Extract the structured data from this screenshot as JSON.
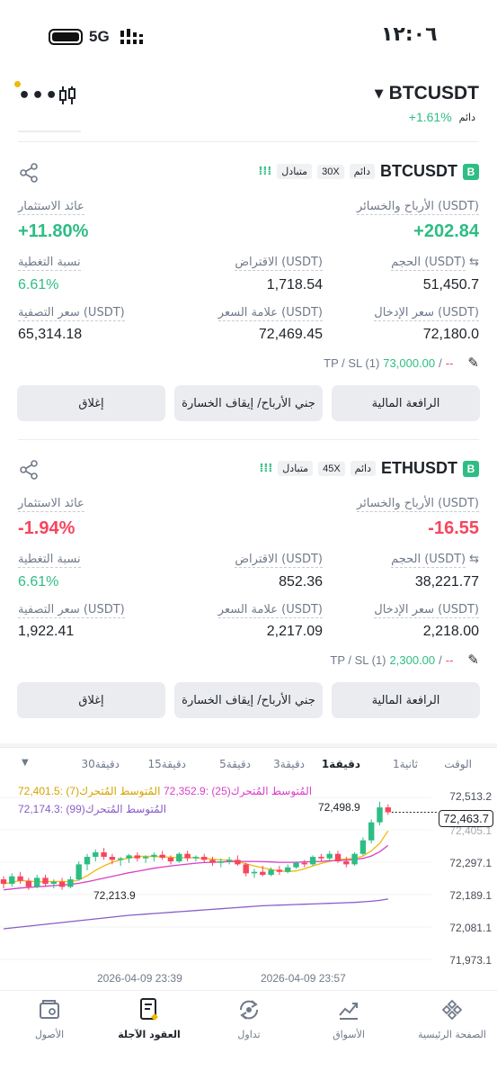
{
  "status_bar": {
    "time": "١٢:٠٦",
    "network": "5G"
  },
  "header": {
    "symbol": "BTCUSDT",
    "type": "دائم",
    "change": "+1.61%"
  },
  "labels": {
    "exchange": "متبادل",
    "perpetual": "دائم",
    "roi": "عائد الاستثمار",
    "pnl": "الأرباح والخسائر (USDT)",
    "margin_ratio": "نسبة التغطية",
    "margin": "الاقتراض (USDT)",
    "size": "الحجم (USDT)",
    "liq_price": "سعر التصفية (USDT)",
    "mark_price": "علامة السعر (USDT)",
    "entry_price": "سعر الإدخال (USDT)",
    "tpsl_prefix": "TP / SL (1)",
    "leverage_btn": "الرافعة المالية",
    "tpsl_btn": "جني الأرباح/ إيقاف الخسارة",
    "close_btn": "إغلاق"
  },
  "positions": [
    {
      "badge": "B",
      "symbol": "BTCUSDT",
      "leverage": "30X",
      "roi": "+11.80%",
      "pnl": "+202.84",
      "margin_ratio": "6.61%",
      "margin": "1,718.54",
      "size": "51,450.7",
      "liq_price": "65,314.18",
      "mark_price": "72,469.45",
      "entry_price": "72,180.0",
      "tp": "73,000.00",
      "sl": "--"
    },
    {
      "badge": "B",
      "symbol": "ETHUSDT",
      "leverage": "45X",
      "roi": "-1.94%",
      "pnl": "-16.55",
      "margin_ratio": "6.61%",
      "margin": "852.36",
      "size": "38,221.77",
      "liq_price": "1,922.41",
      "mark_price": "2,217.09",
      "entry_price": "2,218.00",
      "tp": "2,300.00",
      "sl": "--"
    }
  ],
  "timeframes": [
    "الوقت",
    "1ثانية",
    "1دقيقة",
    "3دقيقة",
    "5دقيقة",
    "15دقيقة",
    "30دقيقة"
  ],
  "chart": {
    "ma7": "المُتوسط المُتحرك(7) :72,401.5",
    "ma25": "المُتوسط المُتحرك(25) :72,352.9",
    "ma99": "المُتوسط المُتحرك(99) :72,174.3",
    "high_label": "72,498.9",
    "low_label": "72,213.9",
    "current_price": "72,463.7",
    "y_labels": [
      "72,513.2",
      "72,405.1",
      "72,297.1",
      "72,189.1",
      "72,081.1",
      "71,973.1"
    ],
    "x_labels": [
      "2026-04-09 23:39",
      "2026-04-09 23:57"
    ],
    "colors": {
      "ma7": "#f0b90b",
      "ma25": "#d93ec8",
      "ma99": "#8a5cc9",
      "up": "#2ebd85",
      "down": "#f6465d"
    }
  },
  "chart_data": {
    "type": "candlestick",
    "ylim": [
      71973.1,
      72513.2
    ],
    "y_ticks": [
      72513.2,
      72405.1,
      72297.1,
      72189.1,
      72081.1,
      71973.1
    ],
    "x_ticks": [
      "2026-04-09 23:39",
      "2026-04-09 23:57"
    ],
    "candles": [
      [
        72240,
        72250,
        72210,
        72225
      ],
      [
        72225,
        72260,
        72215,
        72250
      ],
      [
        72250,
        72265,
        72225,
        72235
      ],
      [
        72235,
        72245,
        72205,
        72215
      ],
      [
        72215,
        72255,
        72210,
        72245
      ],
      [
        72245,
        72255,
        72215,
        72225
      ],
      [
        72225,
        72240,
        72210,
        72232
      ],
      [
        72232,
        72245,
        72205,
        72215
      ],
      [
        72215,
        72250,
        72210,
        72240
      ],
      [
        72240,
        72300,
        72235,
        72290
      ],
      [
        72290,
        72325,
        72270,
        72315
      ],
      [
        72315,
        72340,
        72300,
        72330
      ],
      [
        72330,
        72345,
        72305,
        72315
      ],
      [
        72315,
        72325,
        72290,
        72305
      ],
      [
        72305,
        72315,
        72285,
        72310
      ],
      [
        72310,
        72325,
        72295,
        72320
      ],
      [
        72320,
        72330,
        72300,
        72310
      ],
      [
        72310,
        72320,
        72295,
        72315
      ],
      [
        72315,
        72330,
        72300,
        72322
      ],
      [
        72322,
        72335,
        72305,
        72312
      ],
      [
        72312,
        72320,
        72290,
        72300
      ],
      [
        72300,
        72330,
        72295,
        72325
      ],
      [
        72325,
        72335,
        72300,
        72310
      ],
      [
        72310,
        72320,
        72300,
        72315
      ],
      [
        72315,
        72325,
        72295,
        72305
      ],
      [
        72305,
        72315,
        72285,
        72295
      ],
      [
        72295,
        72310,
        72280,
        72300
      ],
      [
        72300,
        72315,
        72290,
        72305
      ],
      [
        72305,
        72320,
        72285,
        72290
      ],
      [
        72290,
        72295,
        72250,
        72260
      ],
      [
        72260,
        72275,
        72245,
        72265
      ],
      [
        72265,
        72285,
        72250,
        72255
      ],
      [
        72255,
        72280,
        72250,
        72272
      ],
      [
        72272,
        72285,
        72255,
        72265
      ],
      [
        72265,
        72290,
        72260,
        72280
      ],
      [
        72280,
        72300,
        72275,
        72295
      ],
      [
        72295,
        72305,
        72280,
        72290
      ],
      [
        72290,
        72320,
        72285,
        72315
      ],
      [
        72315,
        72325,
        72300,
        72310
      ],
      [
        72310,
        72335,
        72300,
        72325
      ],
      [
        72325,
        72335,
        72295,
        72300
      ],
      [
        72300,
        72315,
        72280,
        72290
      ],
      [
        72290,
        72330,
        72285,
        72325
      ],
      [
        72325,
        72380,
        72320,
        72370
      ],
      [
        72370,
        72440,
        72360,
        72430
      ],
      [
        72430,
        72498.9,
        72420,
        72480
      ],
      [
        72480,
        72490,
        72455,
        72463.7
      ]
    ],
    "series": [
      {
        "name": "المُتوسط المُتحرك(7)",
        "values": [
          72225,
          72230,
          72236,
          72234,
          72232,
          72232,
          72233,
          72233,
          72232,
          72238,
          72252,
          72270,
          72285,
          72297,
          72305,
          72311,
          72316,
          72317,
          72316,
          72315,
          72314,
          72312,
          72313,
          72312,
          72310,
          72307,
          72305,
          72304,
          72300,
          72292,
          72285,
          72279,
          72273,
          72268,
          72266,
          72268,
          72275,
          72285,
          72293,
          72300,
          72306,
          72308,
          72310,
          72318,
          72335,
          72360,
          72401.5
        ]
      },
      {
        "name": "المُتوسط المُتحرك(25)",
        "values": [
          72205,
          72208,
          72211,
          72213,
          72215,
          72217,
          72219,
          72221,
          72223,
          72227,
          72232,
          72238,
          72244,
          72250,
          72256,
          72262,
          72267,
          72272,
          72277,
          72281,
          72285,
          72288,
          72291,
          72294,
          72296,
          72297,
          72298,
          72299,
          72300,
          72300,
          72300,
          72299,
          72298,
          72297,
          72297,
          72297,
          72298,
          72299,
          72300,
          72302,
          72303,
          72304,
          72306,
          72310,
          72318,
          72332,
          72352.9
        ]
      },
      {
        "name": "المُتوسط المُتحرك(99)",
        "values": [
          72075,
          72078,
          72081,
          72084,
          72087,
          72090,
          72093,
          72096,
          72099,
          72102,
          72105,
          72108,
          72111,
          72114,
          72117,
          72120,
          72122,
          72124,
          72126,
          72128,
          72130,
          72132,
          72134,
          72136,
          72138,
          72140,
          72142,
          72144,
          72146,
          72148,
          72150,
          72152,
          72153,
          72154,
          72155,
          72156,
          72157,
          72158,
          72159,
          72160,
          72161,
          72162,
          72163,
          72165,
          72167,
          72170,
          72174.3
        ]
      }
    ]
  },
  "bottom_nav": [
    {
      "label": "الصفحة الرئيسية",
      "icon": "binance-logo-icon"
    },
    {
      "label": "الأسواق",
      "icon": "markets-chart-icon"
    },
    {
      "label": "تداول",
      "icon": "trade-icon"
    },
    {
      "label": "العقود الآجلة",
      "icon": "futures-doc-icon"
    },
    {
      "label": "الأصول",
      "icon": "wallet-icon"
    }
  ]
}
